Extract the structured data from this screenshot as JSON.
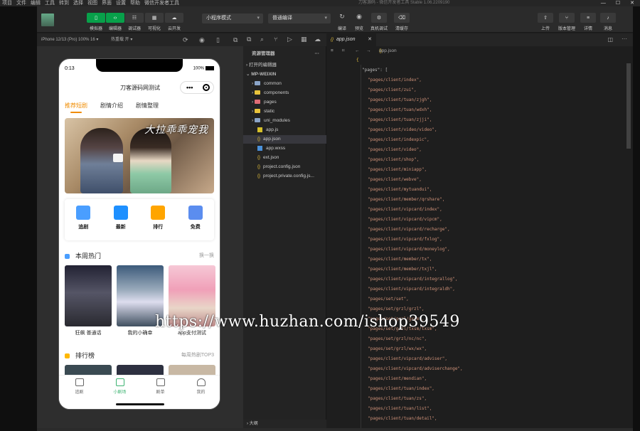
{
  "menubar": {
    "items": [
      "项目",
      "文件",
      "编辑",
      "工具",
      "转到",
      "选择",
      "视图",
      "界面",
      "设置",
      "帮助",
      "微信开发者工具"
    ],
    "window_title": "刀客源码 - 微信开发者工具 Stable 1.06.2209190"
  },
  "toolbar": {
    "buttons": [
      {
        "label": "模拟器",
        "icon": "phone-icon"
      },
      {
        "label": "编辑器",
        "icon": "code-icon"
      },
      {
        "label": "调试器",
        "icon": "bug-icon"
      },
      {
        "label": "可视化",
        "icon": "layout-icon"
      },
      {
        "label": "云开发",
        "icon": "cloud-icon"
      }
    ],
    "mode_select": "小程序模式",
    "compile_select": "普通编译",
    "actions": [
      {
        "label": "编译",
        "icon": "refresh-icon"
      },
      {
        "label": "预览",
        "icon": "eye-icon"
      },
      {
        "label": "真机调试",
        "icon": "debug-icon"
      },
      {
        "label": "清缓存",
        "icon": "clear-icon"
      }
    ],
    "right_actions": [
      {
        "label": "上传",
        "icon": "upload-icon"
      },
      {
        "label": "版本管理",
        "icon": "branch-icon"
      },
      {
        "label": "详情",
        "icon": "menu-icon"
      },
      {
        "label": "消息",
        "icon": "bell-icon"
      }
    ]
  },
  "simulator": {
    "device": "iPhone 12/13 (Pro) 100% 16 ▾",
    "hotreload": "热重载 开 ▾"
  },
  "phone": {
    "time": "0:13",
    "battery": "100%",
    "app_title": "刀客源码网测试",
    "tabs": [
      "推荐短剧",
      "剧情介绍",
      "剧情整理"
    ],
    "banner_title": "大拉乖乖宠我",
    "grid": [
      {
        "label": "追剧",
        "color": "#4a9eff"
      },
      {
        "label": "最新",
        "color": "#1e90ff"
      },
      {
        "label": "排行",
        "color": "#ffa500"
      },
      {
        "label": "免费",
        "color": "#5b8def"
      }
    ],
    "section1": {
      "title": "本周热门",
      "more": "换一换"
    },
    "posters": [
      {
        "caption": "狂飙 普通话"
      },
      {
        "caption": "我的小确幸"
      },
      {
        "caption": "app支付测试"
      }
    ],
    "section2": {
      "title": "排行榜",
      "more": "每周热剧TOP3"
    },
    "bottom_nav": [
      {
        "label": "追剧",
        "active": false
      },
      {
        "label": "小剧场",
        "active": true
      },
      {
        "label": "剧单",
        "active": false
      },
      {
        "label": "我的",
        "active": false
      }
    ]
  },
  "explorer": {
    "title": "资源管理器",
    "open_editors": "打开的编辑器",
    "project": "MP-WEIXIN",
    "items": [
      {
        "name": "common",
        "type": "folder",
        "color": "#8aa4c8"
      },
      {
        "name": "components",
        "type": "folder",
        "color": "#e8c33c"
      },
      {
        "name": "pages",
        "type": "folder",
        "color": "#e06c75"
      },
      {
        "name": "static",
        "type": "folder",
        "color": "#e8c33c"
      },
      {
        "name": "uni_modules",
        "type": "folder",
        "color": "#8aa4c8"
      },
      {
        "name": "app.js",
        "type": "js"
      },
      {
        "name": "app.json",
        "type": "json",
        "selected": true
      },
      {
        "name": "app.wxss",
        "type": "wxss"
      },
      {
        "name": "ext.json",
        "type": "json"
      },
      {
        "name": "project.config.json",
        "type": "json"
      },
      {
        "name": "project.private.config.js...",
        "type": "json"
      }
    ],
    "outline": "大纲"
  },
  "editor": {
    "tab": "app.json",
    "breadcrumb": "app.json > ...",
    "key_line": "\"pages\": [",
    "lines": [
      "\"pages/client/index\",",
      "\"pages/client/zui\",",
      "\"pages/client/tuan/zjgh\",",
      "\"pages/client/tuan/wdxh\",",
      "\"pages/client/tuan/zjji\",",
      "\"pages/client/video/video\",",
      "\"pages/client/indexpic\",",
      "\"pages/client/video\",",
      "\"pages/client/shop\",",
      "\"pages/client/miniapp\",",
      "\"pages/client/webve\",",
      "\"pages/client/mytuandui\",",
      "\"pages/client/member/qrshare\",",
      "\"pages/client/vipcard/index\",",
      "\"pages/client/vipcard/vipcm\",",
      "\"pages/client/vipcard/recharge\",",
      "\"pages/client/vipcard/fxlog\",",
      "\"pages/client/vipcard/moneylog\",",
      "\"pages/client/member/tx\",",
      "\"pages/client/member/txjl\",",
      "\"pages/client/vipcard/integrallog\",",
      "\"pages/client/vipcard/integraldh\",",
      "\"pages/set/set\",",
      "\"pages/set/grzl/grzl\",",
      "\"pages/set/grzl/gxqm\",",
      "\"pages/set/grzl/txsm/txsm\",",
      "\"pages/set/grzl/nc/nc\",",
      "\"pages/set/grzl/wx/wx\",",
      "\"pages/client/vipcard/adviser\",",
      "\"pages/client/vipcard/adviserchange\",",
      "\"pages/client/mendian\",",
      "\"pages/client/tuan/index\",",
      "\"pages/client/tuan/zs\",",
      "\"pages/client/tuan/list\",",
      "\"pages/client/tuan/detail\","
    ]
  },
  "watermark": "https://www.huzhan.com/ishop39549"
}
